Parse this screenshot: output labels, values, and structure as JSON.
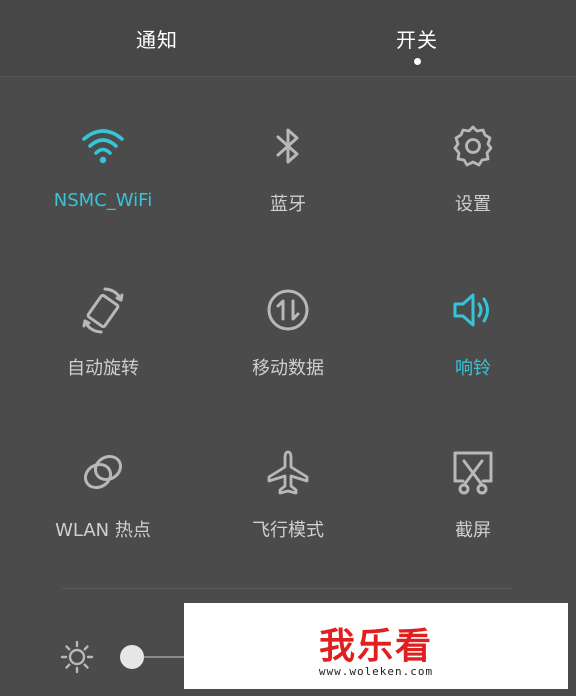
{
  "tabs": {
    "notify": "通知",
    "switches": "开关"
  },
  "tiles": [
    {
      "label": "NSMC_WiFi",
      "icon": "wifi-icon",
      "active": true
    },
    {
      "label": "蓝牙",
      "icon": "bluetooth-icon",
      "active": false
    },
    {
      "label": "设置",
      "icon": "gear-icon",
      "active": false
    },
    {
      "label": "自动旋转",
      "icon": "auto-rotate-icon",
      "active": false
    },
    {
      "label": "移动数据",
      "icon": "mobile-data-icon",
      "active": false
    },
    {
      "label": "响铃",
      "icon": "speaker-icon",
      "active": true
    },
    {
      "label": "WLAN 热点",
      "icon": "hotspot-icon",
      "active": false
    },
    {
      "label": "飞行模式",
      "icon": "airplane-icon",
      "active": false
    },
    {
      "label": "截屏",
      "icon": "screenshot-icon",
      "active": false
    }
  ],
  "brightness": {
    "icon": "brightness-icon"
  },
  "watermark": {
    "brand": "我乐看",
    "url": "www.woleken.com"
  },
  "colors": {
    "active": "#36c5d8",
    "inactive": "#b8b8b8",
    "background": "#4b4b4b"
  }
}
